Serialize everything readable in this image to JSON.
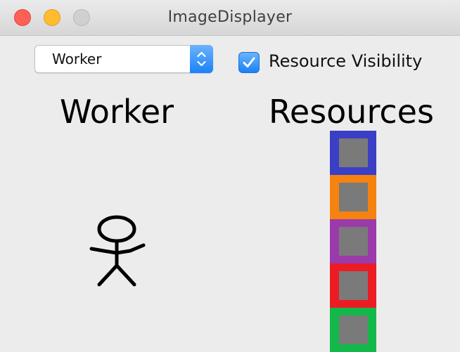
{
  "window": {
    "title": "ImageDisplayer"
  },
  "controls": {
    "dropdown": {
      "selected": "Worker"
    },
    "checkbox": {
      "label": "Resource Visibility",
      "checked": true
    }
  },
  "panels": {
    "worker": {
      "heading": "Worker",
      "icon": "stick-figure-icon"
    },
    "resources": {
      "heading": "Resources",
      "blocks": [
        {
          "border_color": "#3b3fc6"
        },
        {
          "border_color": "#f6820f"
        },
        {
          "border_color": "#9b3aaa"
        },
        {
          "border_color": "#ec1c24"
        },
        {
          "border_color": "#13b84a"
        }
      ],
      "inner_color": "#7a7a7a"
    }
  },
  "colors": {
    "accent": "#1a82f8",
    "background": "#ececec"
  }
}
